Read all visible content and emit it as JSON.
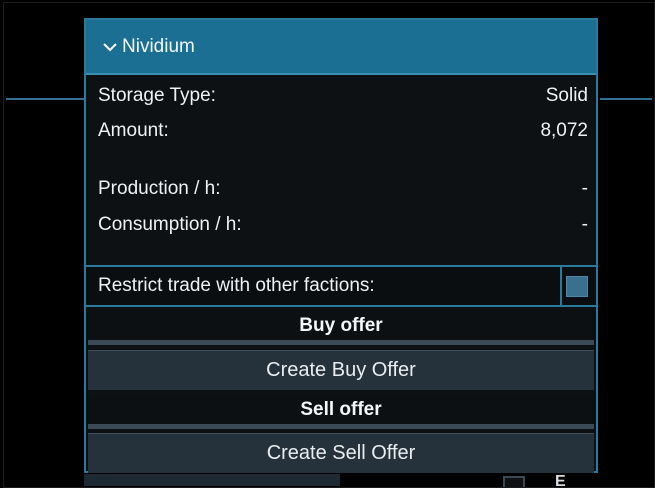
{
  "panel": {
    "title": "Nividium",
    "rows": [
      {
        "label": "Storage Type:",
        "value": "Solid"
      },
      {
        "label": "Amount:",
        "value": "8,072"
      },
      {
        "label": "Production / h:",
        "value": "-"
      },
      {
        "label": "Consumption / h:",
        "value": "-"
      }
    ],
    "restrict_label": "Restrict trade with other factions:",
    "restrict_checked": false,
    "buy": {
      "header": "Buy offer",
      "button": "Create Buy Offer"
    },
    "sell": {
      "header": "Sell offer",
      "button": "Create Sell Offer"
    }
  },
  "background": {
    "partial_label": "E"
  },
  "colors": {
    "accent": "#1a6f93",
    "border": "#2a7a9e",
    "button": "#26323b",
    "panel": "#0d1114"
  },
  "icons": {
    "collapse": "chevron-down-icon"
  }
}
